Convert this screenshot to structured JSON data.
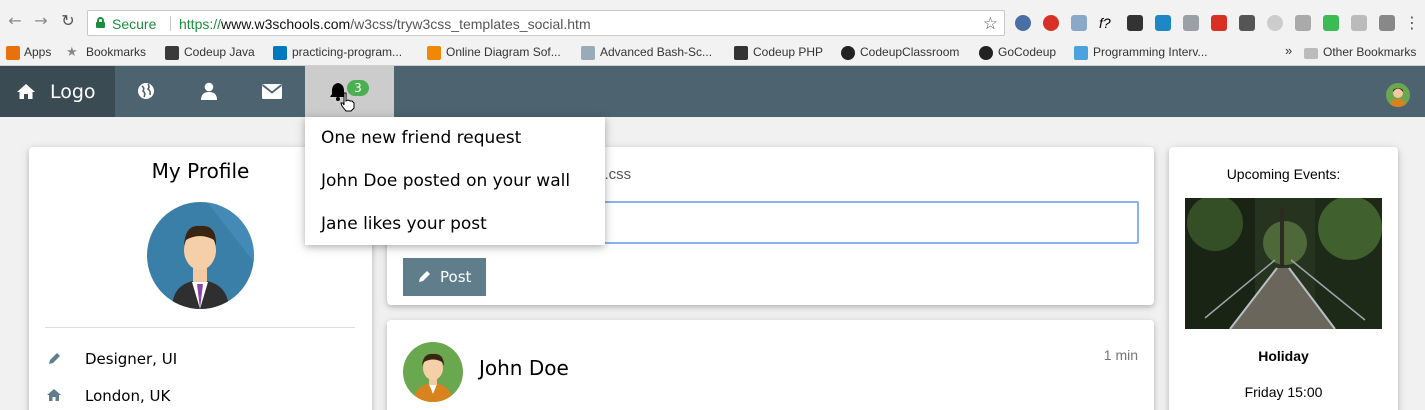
{
  "browser": {
    "secure_label": "Secure",
    "url_proto": "https://",
    "url_host": "www.w3schools.com",
    "url_path": "/w3css/tryw3css_templates_social.htm",
    "bookmarks": [
      {
        "label": "Apps",
        "icon": "apps-grid-icon"
      },
      {
        "label": "Bookmarks",
        "icon": "star-icon"
      },
      {
        "label": "Codeup Java",
        "icon": "codeup-icon"
      },
      {
        "label": "practicing-program...",
        "icon": "trello-icon"
      },
      {
        "label": "Online Diagram Sof...",
        "icon": "diagram-icon"
      },
      {
        "label": "Advanced Bash-Sc...",
        "icon": "page-icon"
      },
      {
        "label": "Codeup PHP",
        "icon": "php-icon"
      },
      {
        "label": "CodeupClassroom",
        "icon": "github-icon"
      },
      {
        "label": "GoCodeup",
        "icon": "github-icon"
      },
      {
        "label": "Programming Interv...",
        "icon": "stack-icon"
      }
    ],
    "other_bookmarks": "Other Bookmarks",
    "overflow": "»"
  },
  "nav": {
    "logo": "Logo",
    "badge_count": "3"
  },
  "notifications": [
    "One new friend request",
    "John Doe posted on your wall",
    "Jane likes your post"
  ],
  "profile": {
    "title": "My Profile",
    "job": "Designer, UI",
    "location": "London, UK"
  },
  "status": {
    "text_partial": "s.css",
    "post_label": "Post"
  },
  "feed": {
    "name": "John Doe",
    "time": "1 min"
  },
  "events": {
    "title": "Upcoming Events:",
    "name": "Holiday",
    "time": "Friday 15:00"
  },
  "colors": {
    "nav_bg": "#4d636f",
    "logo_bg": "#3a4b53",
    "badge": "#4caf50",
    "post_button": "#607d8b"
  }
}
